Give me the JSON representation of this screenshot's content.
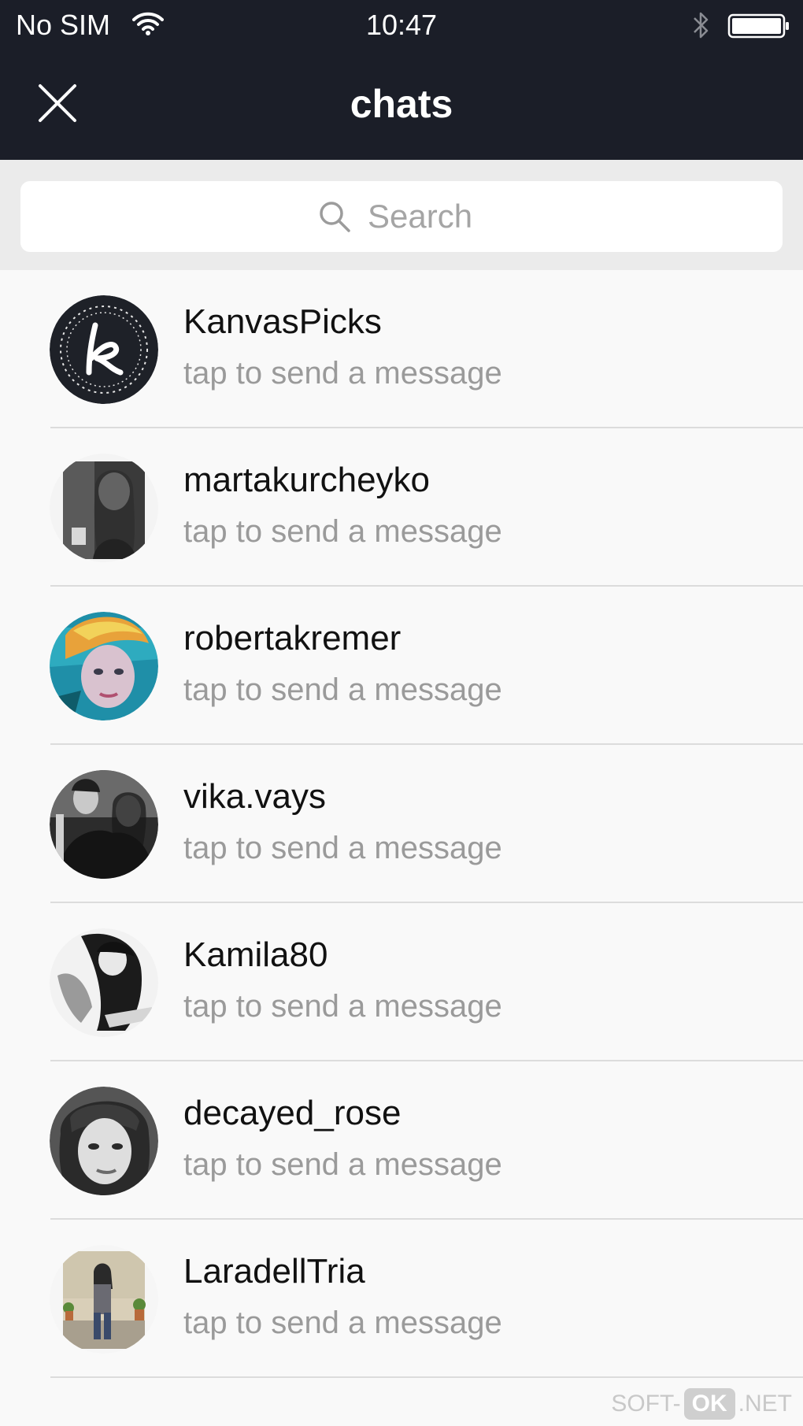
{
  "status_bar": {
    "carrier": "No SIM",
    "time": "10:47",
    "wifi_icon": "wifi-icon",
    "bluetooth_icon": "bluetooth-icon",
    "battery_icon": "battery-icon"
  },
  "header": {
    "title": "chats",
    "close_icon": "close-icon",
    "background_color": "#1b1e28"
  },
  "search": {
    "placeholder": "Search",
    "icon": "search-icon"
  },
  "chats": [
    {
      "name": "KanvasPicks",
      "subtitle": "tap to send a message"
    },
    {
      "name": "martakurcheyko",
      "subtitle": "tap to send a message"
    },
    {
      "name": "robertakremer",
      "subtitle": "tap to send a message"
    },
    {
      "name": "vika.vays",
      "subtitle": "tap to send a message"
    },
    {
      "name": "Kamila80",
      "subtitle": "tap to send a message"
    },
    {
      "name": "decayed_rose",
      "subtitle": "tap to send a message"
    },
    {
      "name": "LaradellTria",
      "subtitle": "tap to send a message"
    }
  ],
  "watermark": {
    "prefix": "SOFT-",
    "badge": "OK",
    "suffix": ".NET"
  }
}
